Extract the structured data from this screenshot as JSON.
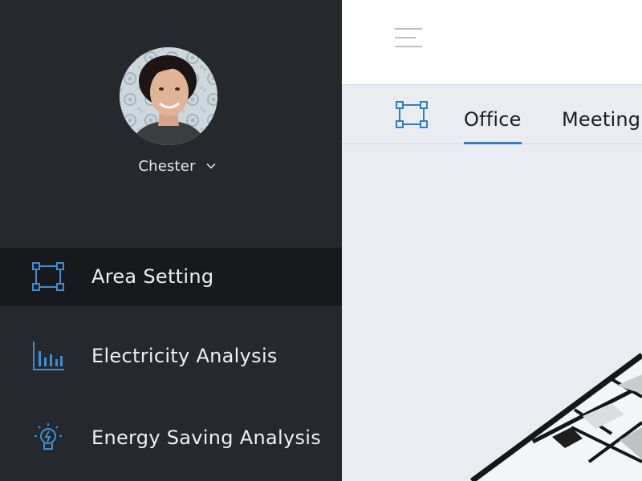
{
  "user": {
    "name": "Chester"
  },
  "sidebar": {
    "items": [
      {
        "label": "Area Setting",
        "icon": "area-setting-icon",
        "active": true
      },
      {
        "label": "Electricity Analysis",
        "icon": "bar-chart-icon",
        "active": false
      },
      {
        "label": "Energy Saving Analysis",
        "icon": "lightbulb-icon",
        "active": false
      }
    ]
  },
  "header": {
    "menu_icon": "hamburger-icon"
  },
  "tabs": {
    "icon": "area-setting-icon",
    "items": [
      {
        "label": "Office",
        "active": true
      },
      {
        "label": "Meeting",
        "active": false
      }
    ]
  },
  "colors": {
    "sidebar_bg": "#25292d",
    "active_item_bg": "#17191c",
    "accent": "#2f7fc1",
    "main_bg": "#e9edf1"
  }
}
